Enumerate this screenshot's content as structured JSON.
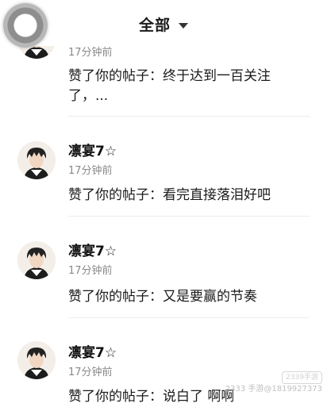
{
  "header": {
    "title": "全部"
  },
  "notifications": [
    {
      "username": "",
      "time": "17分钟前",
      "message": "赞了你的帖子：终于达到一百关注了，..."
    },
    {
      "username": "凛宴7☆",
      "time": "17分钟前",
      "message": "赞了你的帖子：看完直接落泪好吧"
    },
    {
      "username": "凛宴7☆",
      "time": "17分钟前",
      "message": "赞了你的帖子：又是要赢的节奏"
    },
    {
      "username": "凛宴7☆",
      "time": "17分钟前",
      "message": "赞了你的帖子：说白了 啊啊"
    }
  ],
  "watermark": {
    "badge": "2339手游",
    "text": "2333 手游@1819927373"
  },
  "icons": {
    "floating": "floating-assistive-button",
    "caret": "caret-down-icon"
  }
}
